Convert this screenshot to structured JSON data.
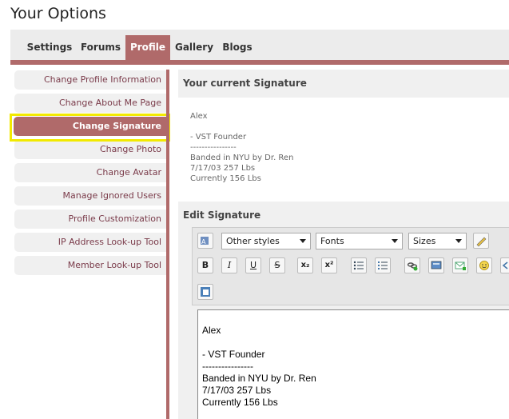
{
  "page": {
    "title": "Your Options"
  },
  "tabs": [
    {
      "label": "Settings"
    },
    {
      "label": "Forums"
    },
    {
      "label": "Profile"
    },
    {
      "label": "Gallery"
    },
    {
      "label": "Blogs"
    }
  ],
  "active_tab": "Profile",
  "sidebar": {
    "items": [
      {
        "label": "Change Profile Information"
      },
      {
        "label": "Change About Me Page"
      },
      {
        "label": "Change Signature"
      },
      {
        "label": "Change Photo"
      },
      {
        "label": "Change Avatar"
      },
      {
        "label": "Manage Ignored Users"
      },
      {
        "label": "Profile Customization"
      },
      {
        "label": "IP Address Look-up Tool"
      },
      {
        "label": "Member Look-up Tool"
      }
    ],
    "active": "Change Signature"
  },
  "current_signature": {
    "heading": "Your current Signature",
    "lines": [
      "Alex",
      "",
      "- VST Founder",
      "----------------",
      "Banded in NYU by Dr. Ren",
      "7/17/03 257 Lbs",
      "Currently 156 Lbs"
    ]
  },
  "edit_signature": {
    "heading": "Edit Signature",
    "toolbar": {
      "style_select": "Other styles",
      "font_select": "Fonts",
      "size_select": "Sizes",
      "buttons": {
        "bold": "B",
        "italic": "I",
        "underline": "U",
        "strike": "S",
        "subscript": "x₂",
        "superscript": "x²"
      }
    },
    "editor_lines": [
      "Alex",
      "",
      "- VST Founder",
      "----------------",
      "Banded in NYU by Dr. Ren",
      "7/17/03 257 Lbs",
      "Currently 156 Lbs"
    ]
  },
  "colors": {
    "accent": "#b06a6a",
    "highlight": "#f2ea00",
    "link": "#7a3b4a"
  }
}
